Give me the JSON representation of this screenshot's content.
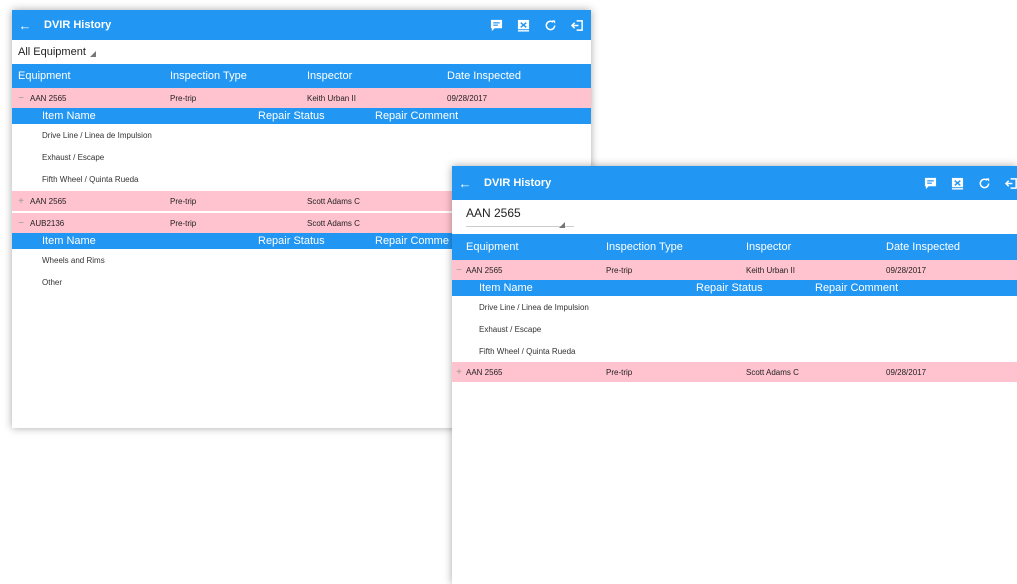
{
  "colors": {
    "header_blue": "#2196f3",
    "row_pink": "#ffc3cf",
    "toolbar_blue": "#2196f3"
  },
  "icons": [
    "back-arrow-icon",
    "comment-icon",
    "certify-icon",
    "refresh-icon",
    "logout-icon"
  ],
  "back_symbol": "←",
  "screen_a": {
    "title": "DVIR History",
    "filter": "All Equipment",
    "columns": [
      "Equipment",
      "Inspection Type",
      "Inspector",
      "Date Inspected"
    ],
    "rows": [
      {
        "toggle": "−",
        "equipment": "AAN 2565",
        "type": "Pre-trip",
        "inspector": "Keith Urban II",
        "date": "09/28/2017",
        "items": [
          "Drive Line / Linea de Impulsion",
          "Exhaust / Escape",
          "Fifth Wheel / Quinta Rueda"
        ]
      },
      {
        "toggle": "+",
        "equipment": "AAN 2565",
        "type": "Pre-trip",
        "inspector": "Scott Adams C",
        "date": ""
      },
      {
        "toggle": "−",
        "equipment": "AUB2136",
        "type": "Pre-trip",
        "inspector": "Scott Adams C",
        "date": "",
        "items": [
          "Wheels and Rims",
          "Other"
        ]
      }
    ],
    "sub_columns": [
      "Item Name",
      "Repair Status",
      "Repair Comment"
    ],
    "sub_columns_b2_comment": "Repair Comme"
  },
  "screen_b": {
    "title": "DVIR History",
    "filter": "AAN 2565",
    "columns": [
      "Equipment",
      "Inspection Type",
      "Inspector",
      "Date Inspected"
    ],
    "rows": [
      {
        "toggle": "−",
        "equipment": "AAN 2565",
        "type": "Pre-trip",
        "inspector": "Keith Urban II",
        "date": "09/28/2017",
        "items": [
          "Drive Line / Linea de Impulsion",
          "Exhaust / Escape",
          "Fifth Wheel / Quinta Rueda"
        ]
      },
      {
        "toggle": "+",
        "equipment": "AAN 2565",
        "type": "Pre-trip",
        "inspector": "Scott Adams C",
        "date": "09/28/2017"
      }
    ],
    "sub_columns": [
      "Item Name",
      "Repair Status",
      "Repair Comment"
    ]
  }
}
